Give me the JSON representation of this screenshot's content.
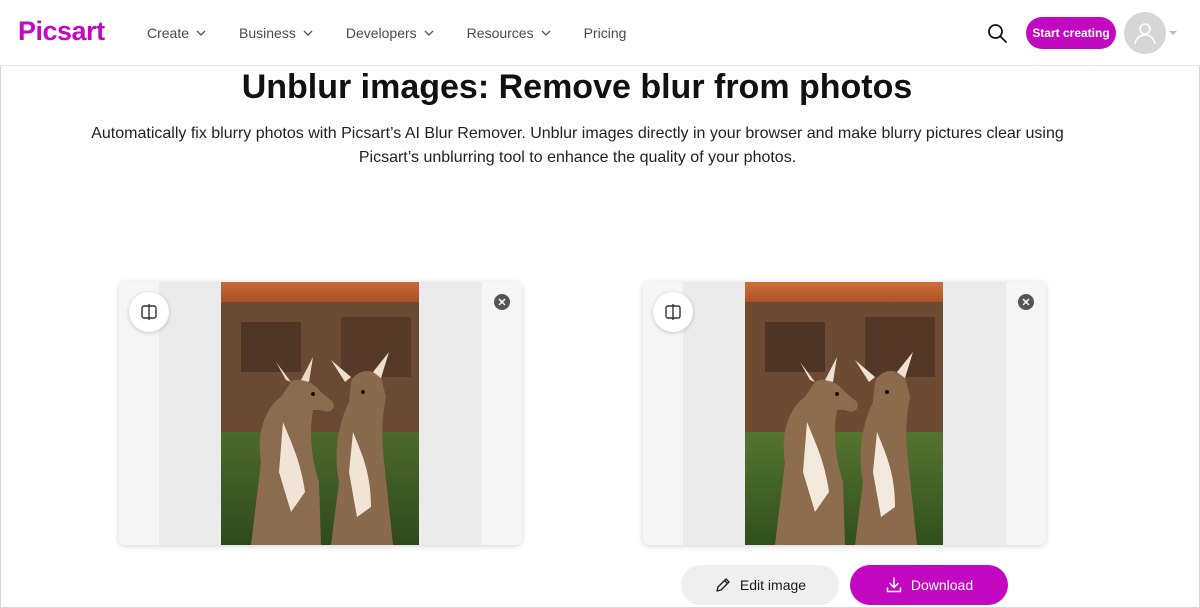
{
  "header": {
    "logo": "Picsart",
    "nav": [
      {
        "label": "Create",
        "has_dropdown": true
      },
      {
        "label": "Business",
        "has_dropdown": true
      },
      {
        "label": "Developers",
        "has_dropdown": true
      },
      {
        "label": "Resources",
        "has_dropdown": true
      },
      {
        "label": "Pricing",
        "has_dropdown": false
      }
    ],
    "search_icon": "search-icon",
    "cta_label": "Start creating",
    "avatar_icon": "user-icon"
  },
  "hero": {
    "title": "Unblur images: Remove blur from photos",
    "subtitle": "Automatically fix blurry photos with Picsart’s AI Blur Remover. Unblur images directly in your browser and make blurry pictures clear using Picsart’s unblurring tool to enhance the quality of your photos."
  },
  "cards": [
    {
      "id": "before",
      "compare_icon": "compare-split-icon",
      "close_icon": "close-icon",
      "image_subject": "two deer"
    },
    {
      "id": "after",
      "compare_icon": "compare-split-icon",
      "close_icon": "close-icon",
      "image_subject": "two deer"
    }
  ],
  "actions": {
    "edit_label": "Edit image",
    "edit_icon": "pencil-icon",
    "download_label": "Download",
    "download_icon": "download-icon"
  },
  "colors": {
    "brand": "#c209c1",
    "nav_text": "#4a4a4a",
    "edit_button_bg": "#efefef"
  }
}
